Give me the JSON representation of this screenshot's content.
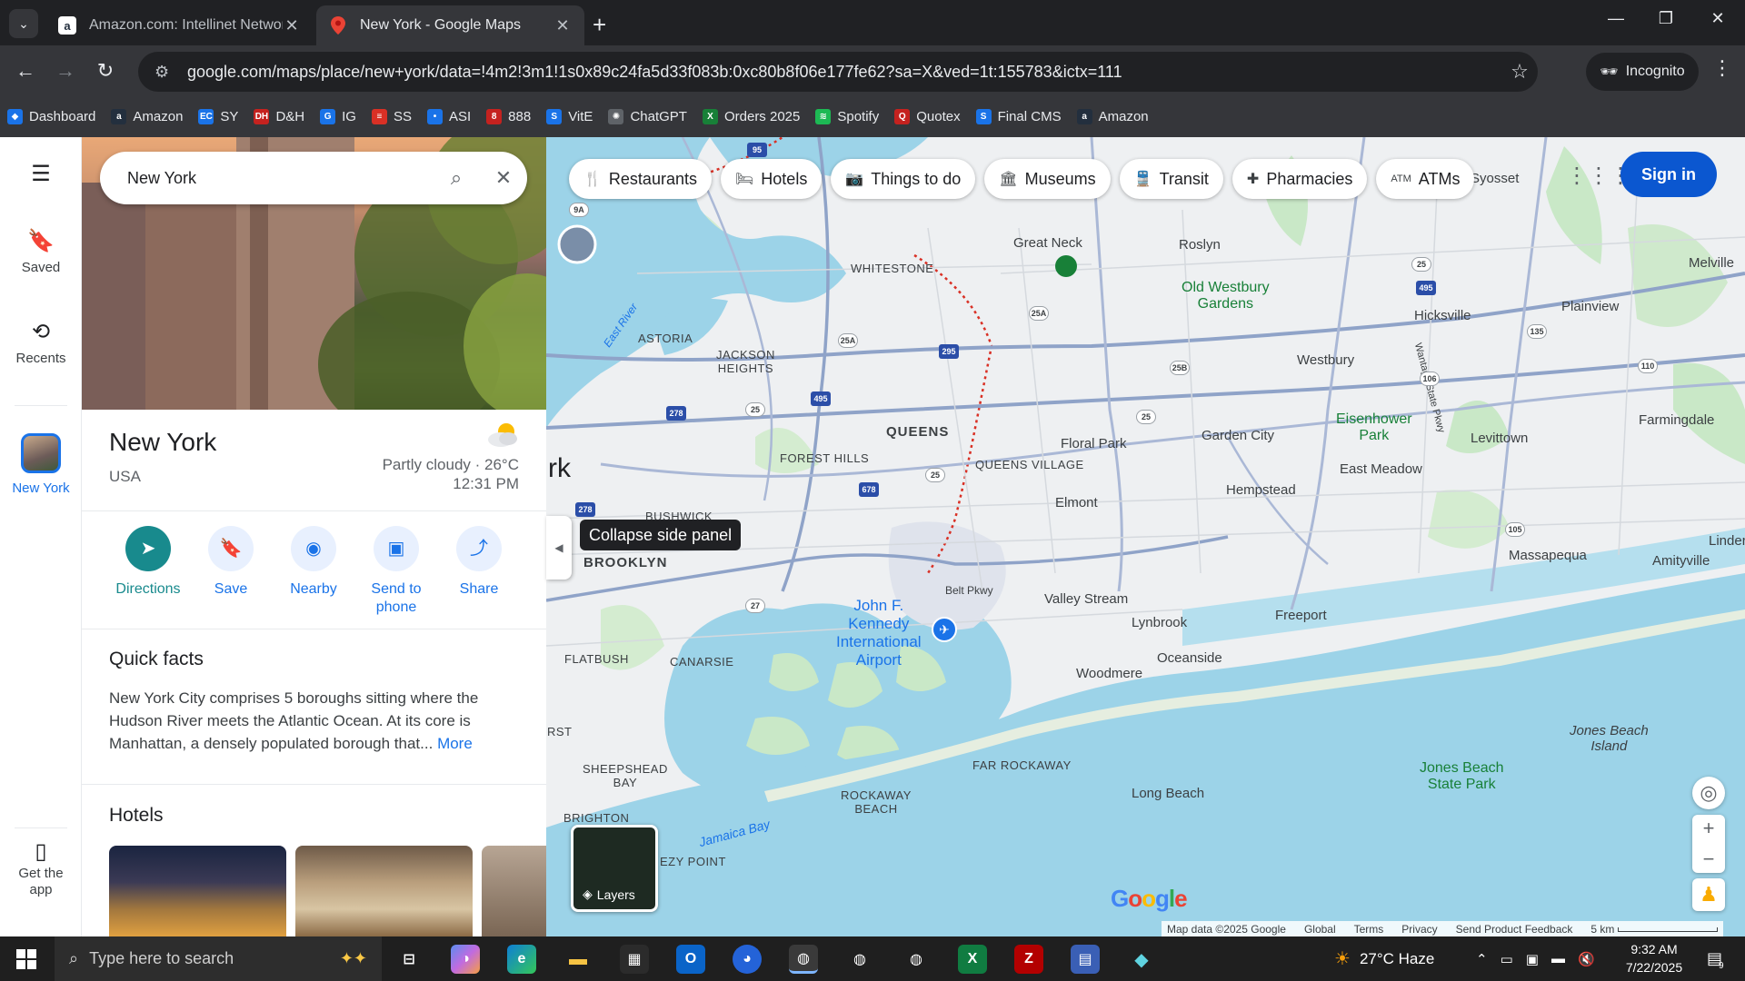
{
  "browser": {
    "tabs": [
      {
        "title": "Amazon.com: Intellinet Networ",
        "active": false,
        "favicon": "a"
      },
      {
        "title": "New York - Google Maps",
        "active": true,
        "favicon": "maps-pin"
      }
    ],
    "url": "google.com/maps/place/new+york/data=!4m2!3m1!1s0x89c24fa5d33f083b:0xc80b8f06e177fe62?sa=X&ved=1t:155783&ictx=111",
    "incognito_label": "Incognito",
    "bookmarks": [
      {
        "label": "Dashboard",
        "color": "#1a73e8",
        "glyph": "◆"
      },
      {
        "label": "Amazon",
        "color": "#232f3e",
        "glyph": "a"
      },
      {
        "label": "SY",
        "color": "#1a73e8",
        "glyph": "EC"
      },
      {
        "label": "D&H",
        "color": "#c5221f",
        "glyph": "DH"
      },
      {
        "label": "IG",
        "color": "#1a73e8",
        "glyph": "G"
      },
      {
        "label": "SS",
        "color": "#d93025",
        "glyph": "≡"
      },
      {
        "label": "ASI",
        "color": "#1a73e8",
        "glyph": "•"
      },
      {
        "label": "888",
        "color": "#c5221f",
        "glyph": "8"
      },
      {
        "label": "VitE",
        "color": "#1a73e8",
        "glyph": "S"
      },
      {
        "label": "ChatGPT",
        "color": "#5f6368",
        "glyph": "✺"
      },
      {
        "label": "Orders 2025",
        "color": "#188038",
        "glyph": "X"
      },
      {
        "label": "Spotify",
        "color": "#1db954",
        "glyph": "≋"
      },
      {
        "label": "Quotex",
        "color": "#c5221f",
        "glyph": "Q"
      },
      {
        "label": "Final CMS",
        "color": "#1a73e8",
        "glyph": "S"
      },
      {
        "label": "Amazon",
        "color": "#232f3e",
        "glyph": "a"
      }
    ]
  },
  "rail": {
    "saved": "Saved",
    "recents": "Recents",
    "current": "New York",
    "get_app": "Get the app"
  },
  "search": {
    "value": "New York"
  },
  "place": {
    "title": "New York",
    "subtitle": "USA",
    "weather": "Partly cloudy · 26°C",
    "time": "12:31 PM"
  },
  "actions": [
    {
      "label": "Directions",
      "icon": "directions-icon"
    },
    {
      "label": "Save",
      "icon": "bookmark-icon"
    },
    {
      "label": "Nearby",
      "icon": "nearby-icon"
    },
    {
      "label": "Send to phone",
      "icon": "send-to-phone-icon"
    },
    {
      "label": "Share",
      "icon": "share-icon"
    }
  ],
  "quick_facts": {
    "title": "Quick facts",
    "text": "New York City comprises 5 boroughs sitting where the Hudson River meets the Atlantic Ocean. At its core is Manhattan, a densely populated borough that...",
    "more": "More"
  },
  "hotels": {
    "title": "Hotels"
  },
  "tooltip": "Collapse side panel",
  "chips": [
    {
      "label": "Restaurants",
      "icon": "🍴"
    },
    {
      "label": "Hotels",
      "icon": "🛏"
    },
    {
      "label": "Things to do",
      "icon": "📷"
    },
    {
      "label": "Museums",
      "icon": "🏛"
    },
    {
      "label": "Transit",
      "icon": "🚆"
    },
    {
      "label": "Pharmacies",
      "icon": "✚"
    },
    {
      "label": "ATMs",
      "icon": "ATM"
    }
  ],
  "signin": "Sign in",
  "map_labels": {
    "queens": "QUEENS",
    "brooklyn": "BROOKLYN",
    "whitestone": "WHITESTONE",
    "astoria": "ASTORIA",
    "jackson_heights": "JACKSON\nHEIGHTS",
    "forest_hills": "FOREST HILLS",
    "queens_village": "QUEENS VILLAGE",
    "bushwick": "BUSHWICK",
    "flatbush": "FLATBUSH",
    "canarsie": "CANARSIE",
    "sheepshead_bay": "SHEEPSHEAD\nBAY",
    "brighton": "BRIGHTON",
    "rockaway_beach": "ROCKAWAY\nBEACH",
    "far_rockaway": "FAR ROCKAWAY",
    "breezy_point": "EZY POINT",
    "great_neck": "Great Neck",
    "roslyn": "Roslyn",
    "syosset": "Syosset",
    "melville": "Melville",
    "old_westbury": "Old Westbury\nGardens",
    "hicksville": "Hicksville",
    "plainview": "Plainview",
    "westbury": "Westbury",
    "farmingdale": "Farmingdale",
    "floral_park": "Floral Park",
    "garden_city": "Garden City",
    "eisenhower": "Eisenhower\nPark",
    "levittown": "Levittown",
    "east_meadow": "East Meadow",
    "hempstead": "Hempstead",
    "elmont": "Elmont",
    "massapequa": "Massapequa",
    "amityville": "Amityville",
    "linden": "Linder",
    "valley_stream": "Valley Stream",
    "lynbrook": "Lynbrook",
    "freeport": "Freeport",
    "oceanside": "Oceanside",
    "woodmere": "Woodmere",
    "long_beach": "Long Beach",
    "jones_beach_island": "Jones Beach\nIsland",
    "jones_beach_park": "Jones Beach\nState Park",
    "jfk": "John F.\nKennedy\nInternational\nAirport",
    "belt_pkwy": "Belt Pkwy",
    "jamaica_bay": "Jamaica Bay",
    "east_river": "East River",
    "wantagh": "Wantagh State Pkwy",
    "rk": "rk",
    "rst": "RST"
  },
  "shields": [
    "95",
    "278",
    "495",
    "295",
    "678",
    "25A",
    "25",
    "25B",
    "27",
    "495",
    "25",
    "110",
    "135",
    "106",
    "105",
    "9A",
    "278",
    "25A",
    "25",
    "25"
  ],
  "layers_label": "Layers",
  "attribution": {
    "map_data": "Map data ©2025 Google",
    "global": "Global",
    "terms": "Terms",
    "privacy": "Privacy",
    "feedback": "Send Product Feedback",
    "scale": "5 km"
  },
  "taskbar": {
    "search_placeholder": "Type here to search",
    "weather": "27°C  Haze",
    "time": "9:32 AM",
    "date": "7/22/2025",
    "notif_count": "9"
  }
}
